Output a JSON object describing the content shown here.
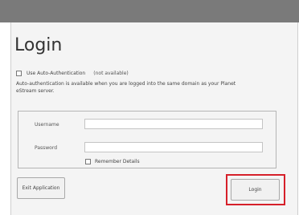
{
  "window": {
    "title": "Login"
  },
  "auto_auth": {
    "label": "Use Auto-Authentication",
    "status": "(not available)",
    "description": "Auto-authentication is available when you are logged into the same domain as your Planet eStream server."
  },
  "form": {
    "username_label": "Username",
    "username_value": "",
    "password_label": "Password",
    "password_value": "",
    "remember_label": "Remember Details"
  },
  "buttons": {
    "exit_label": "Exit Application",
    "login_label": "Login"
  },
  "colors": {
    "highlight": "#d6202a"
  }
}
